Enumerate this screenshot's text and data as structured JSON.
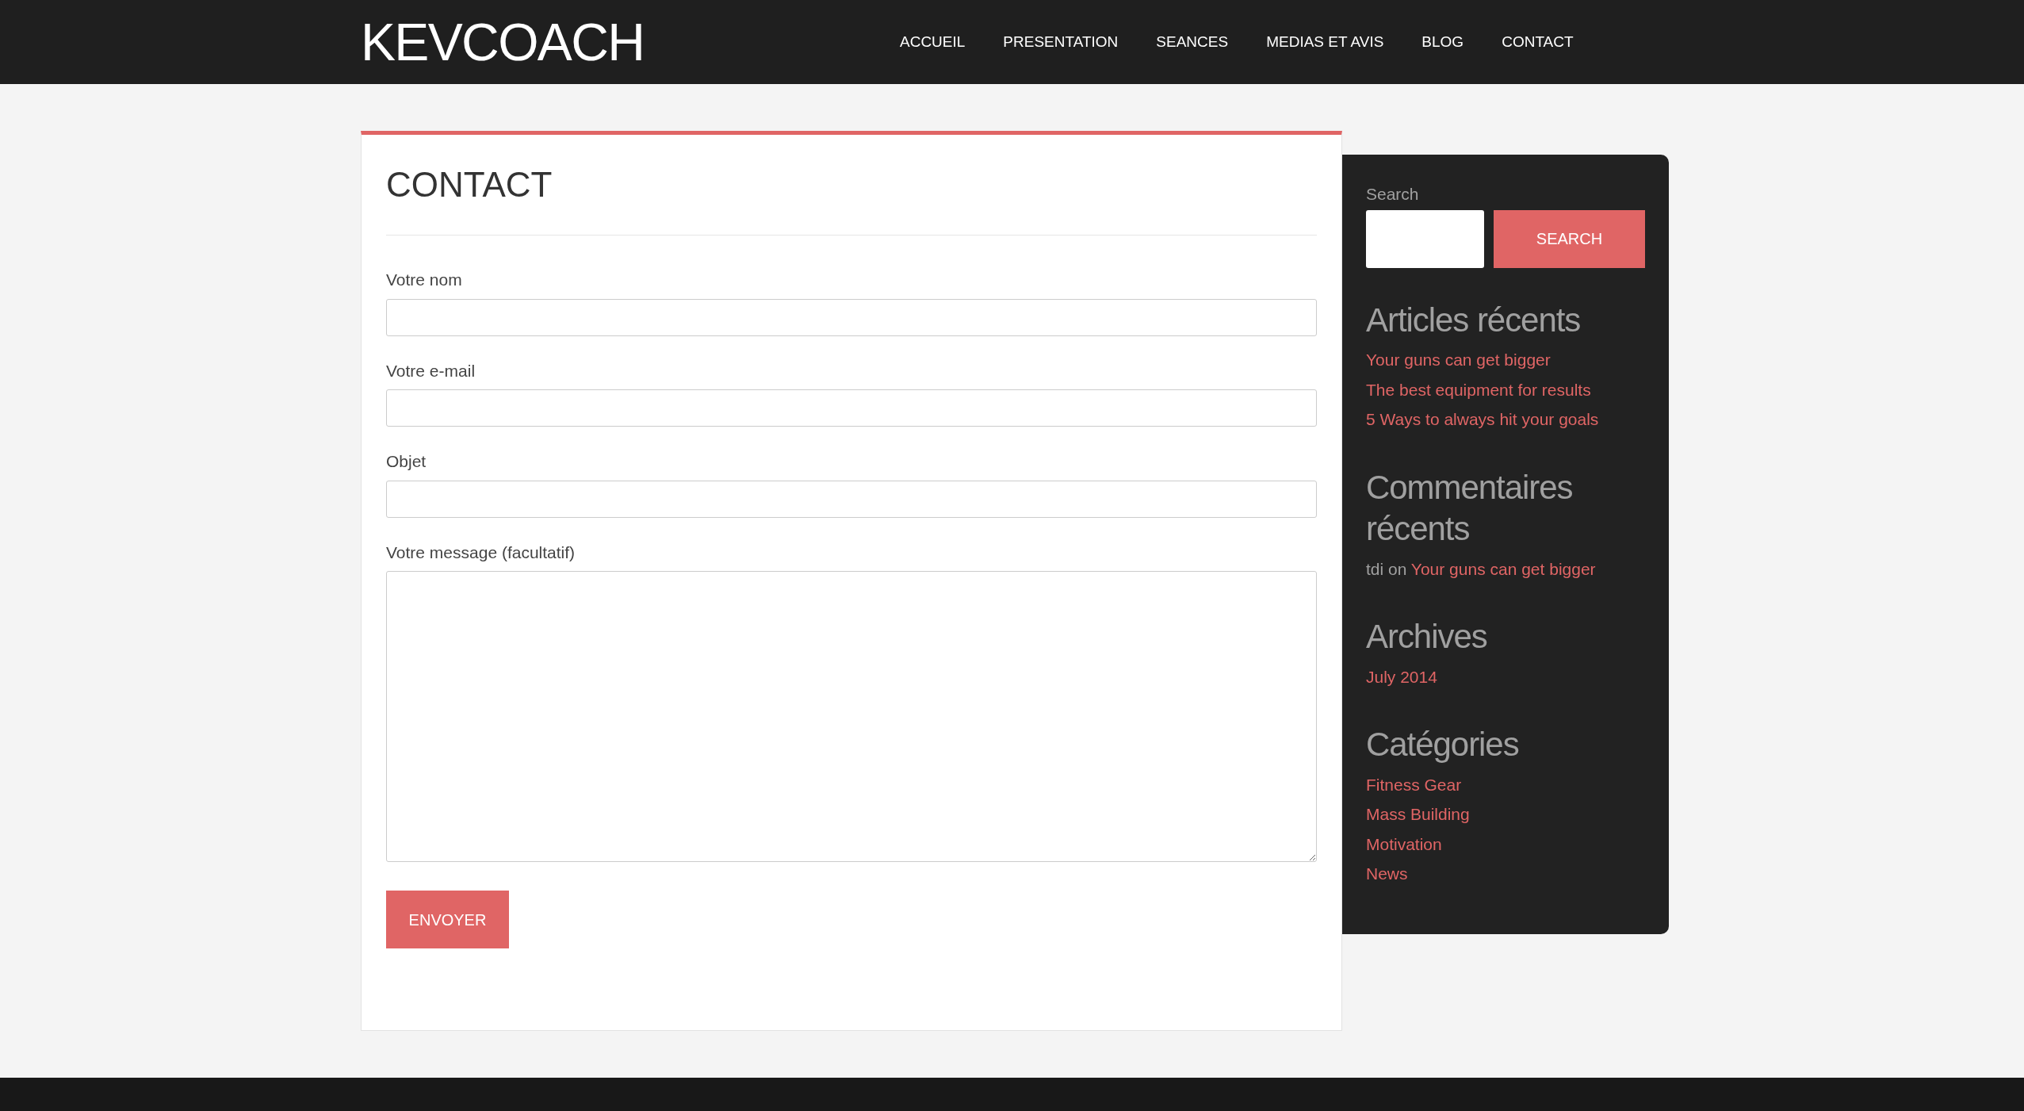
{
  "header": {
    "logo": "KEVCOACH",
    "nav": [
      {
        "label": "ACCUEIL",
        "selected": false
      },
      {
        "label": "PRESENTATION",
        "selected": false
      },
      {
        "label": "SEANCES",
        "selected": false
      },
      {
        "label": "MEDIAS ET AVIS",
        "selected": false
      },
      {
        "label": "BLOG",
        "selected": false
      },
      {
        "label": "CONTACT",
        "selected": false
      }
    ]
  },
  "form": {
    "title": "CONTACT",
    "fields": [
      {
        "kind": "input",
        "label": "Votre nom"
      },
      {
        "kind": "input",
        "label": "Votre e-mail"
      },
      {
        "kind": "input",
        "label": "Objet"
      },
      {
        "kind": "textarea",
        "label": "Votre message (facultatif)"
      }
    ],
    "submit": "ENVOYER"
  },
  "sidebar": {
    "search": {
      "label": "Search",
      "button": "SEARCH"
    },
    "recent_articles": {
      "title": "Articles récents",
      "items": [
        "Your guns can get bigger",
        "The best equipment for results",
        "5 Ways to always hit your goals"
      ]
    },
    "recent_comments": {
      "title": "Commentaires récents",
      "items": [
        {
          "author": "tdi",
          "connector": "on",
          "link": "Your guns can get bigger"
        }
      ]
    },
    "archives": {
      "title": "Archives",
      "items": [
        "July 2014"
      ]
    },
    "categories": {
      "title": "Catégories",
      "items": [
        "Fitness Gear",
        "Mass Building",
        "Motivation",
        "News"
      ]
    }
  }
}
